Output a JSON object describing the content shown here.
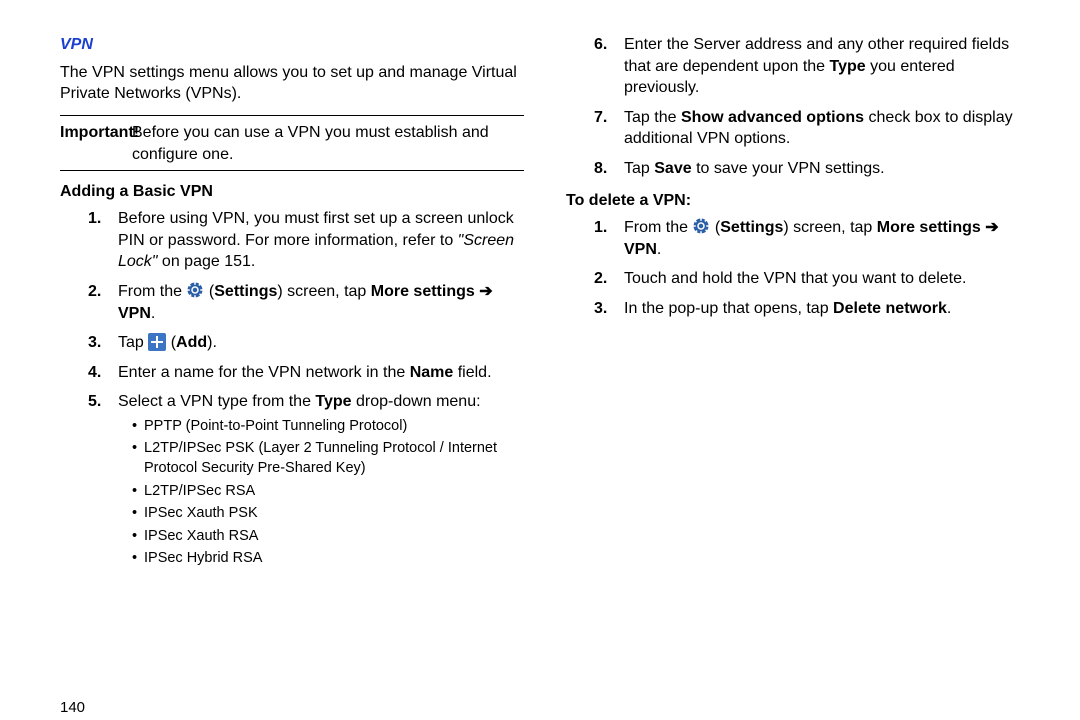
{
  "section_title": "VPN",
  "intro": "The VPN settings menu allows you to set up and manage Virtual Private Networks (VPNs).",
  "important_label": "Important!",
  "important_body": "Before you can use a VPN you must establish and configure one.",
  "adding_heading": "Adding a Basic VPN",
  "left_steps": {
    "s1": {
      "num": "1.",
      "a": "Before using VPN, you must first set up a screen unlock PIN or password. For more information, refer to ",
      "ref": "\"Screen Lock\"",
      "b": " on page 151."
    },
    "s2": {
      "num": "2.",
      "a": "From the ",
      "settings_label": "Settings",
      "b": ") screen, tap ",
      "more": "More settings",
      "arrow": " ➔ ",
      "vpn": "VPN",
      "dot": "."
    },
    "s3": {
      "num": "3.",
      "a": "Tap ",
      "add_label": "Add",
      "b": ")."
    },
    "s4": {
      "num": "4.",
      "a": "Enter a name for the VPN network in the ",
      "name": "Name",
      "b": " field."
    },
    "s5": {
      "num": "5.",
      "a": "Select a VPN type from the ",
      "type": "Type",
      "b": " drop-down menu:"
    }
  },
  "vpn_types": [
    "PPTP (Point-to-Point Tunneling Protocol)",
    "L2TP/IPSec PSK (Layer 2 Tunneling Protocol / Internet Protocol Security Pre-Shared Key)",
    "L2TP/IPSec RSA",
    "IPSec Xauth PSK",
    "IPSec Xauth RSA",
    "IPSec Hybrid RSA"
  ],
  "right_steps": {
    "s6": {
      "num": "6.",
      "a": "Enter the Server address and any other required fields that are dependent upon the ",
      "type": "Type",
      "b": " you entered previously."
    },
    "s7": {
      "num": "7.",
      "a": "Tap the ",
      "opt": "Show advanced options",
      "b": " check box to display additional VPN options."
    },
    "s8": {
      "num": "8.",
      "a": "Tap ",
      "save": "Save",
      "b": " to save your VPN settings."
    }
  },
  "delete_heading": "To delete a VPN:",
  "delete_steps": {
    "d1": {
      "num": "1.",
      "a": "From the ",
      "settings_label": "Settings",
      "b": ") screen, tap ",
      "more": "More settings",
      "arrow": " ➔ ",
      "vpn": "VPN",
      "dot": "."
    },
    "d2": {
      "num": "2.",
      "a": "Touch and hold the VPN that you want to delete."
    },
    "d3": {
      "num": "3.",
      "a": "In the pop-up that opens, tap ",
      "del": "Delete network",
      "b": "."
    }
  },
  "page_number": "140"
}
